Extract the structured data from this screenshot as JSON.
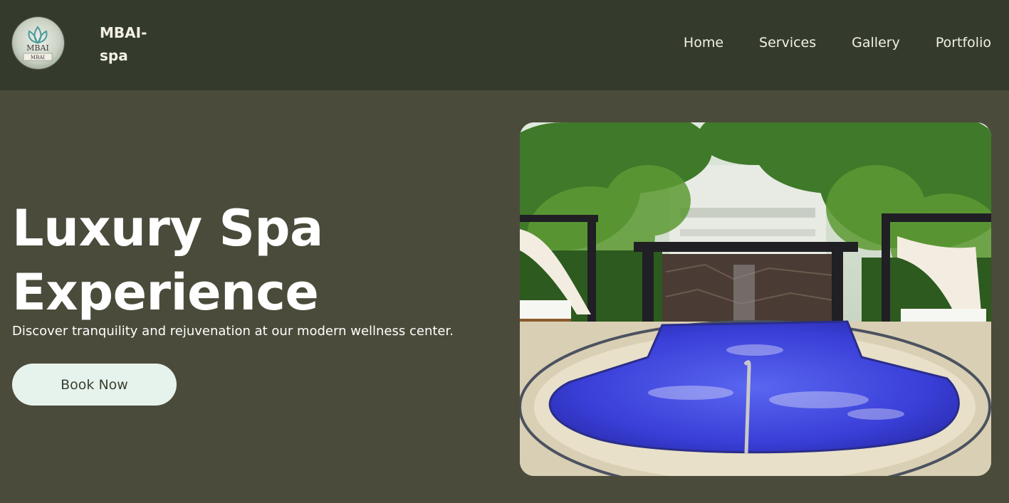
{
  "header": {
    "brand_name": "MBAI-\nspa",
    "logo_text": "MBAI"
  },
  "nav": {
    "items": [
      {
        "label": "Home"
      },
      {
        "label": "Services"
      },
      {
        "label": "Gallery"
      },
      {
        "label": "Portfolio"
      }
    ]
  },
  "hero": {
    "title": "Luxury Spa Experience",
    "subtitle": "Discover tranquility and rejuvenation at our modern wellness center.",
    "cta_label": "Book Now"
  },
  "colors": {
    "header_bg": "#353b2c",
    "hero_bg": "#4b4b3b",
    "cta_bg": "#e6f3ec",
    "pool_blue": "#3a3fd8"
  }
}
